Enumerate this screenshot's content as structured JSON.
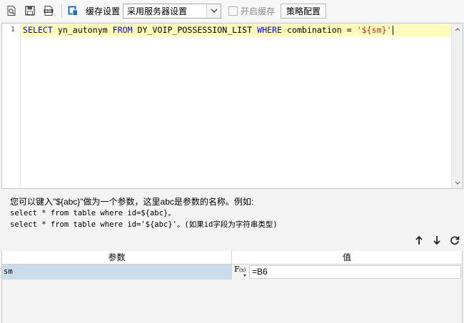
{
  "toolbar": {
    "icons": [
      "preview-icon",
      "save-icon",
      "sql-icon",
      "cache-icon"
    ],
    "cache_label": "缓存设置",
    "cache_select_value": "采用服务器设置",
    "enable_cache_label": "开启缓存",
    "strategy_button": "策略配置"
  },
  "editor": {
    "line_number": "1",
    "sql": {
      "select": "SELECT",
      "column": " yn_autonym ",
      "from": "FROM",
      "table": " DY_VOIP_POSSESSION_LIST ",
      "where": "WHERE",
      "condition": " combination = ",
      "param": "'${sm}'"
    },
    "highlight_color": "#fffbb8",
    "keyword_color": "#0000ff",
    "string_color": "#c82828"
  },
  "help": {
    "line1": "您可以键入\"${abc}\"做为一个参数，这里abc是参数的名称。例如:",
    "line2": "select * from table where id=${abc}。",
    "line3": "select * from table where id='${abc}'。(如果id字段为字符串类型)"
  },
  "params": {
    "tools": [
      "arrow-up-icon",
      "arrow-down-icon",
      "refresh-icon"
    ],
    "headers": {
      "name": "参数",
      "value": "值"
    },
    "rows": [
      {
        "name": "sm",
        "formula_icon": "F(x)",
        "value": "=B6"
      }
    ],
    "selected_row_color": "#c9dcea"
  }
}
